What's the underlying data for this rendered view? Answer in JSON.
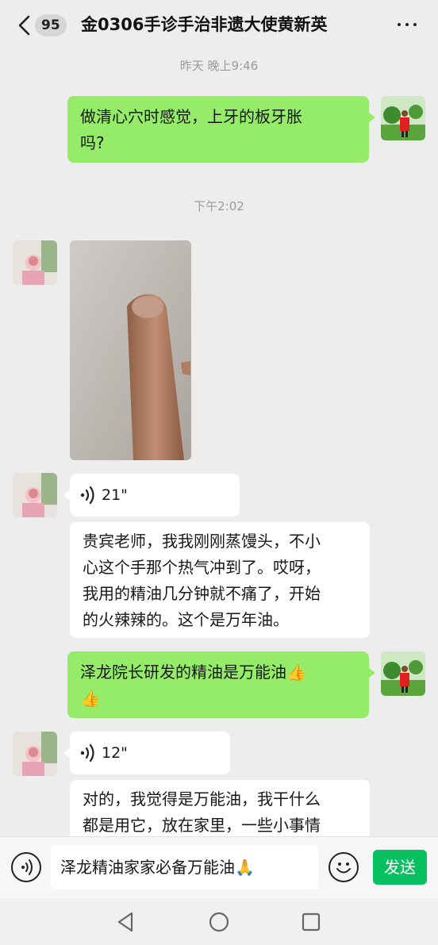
{
  "header": {
    "unread_count": "95",
    "title": "金0306手诊手治非遗大使黄新英"
  },
  "messages": {
    "ts1": "昨天 晚上9:46",
    "msg1_line1": "做清心穴时感觉，上牙的板牙胀",
    "msg1_line2": "吗?",
    "ts2": "下午2:02",
    "voice1_duration": "21\"",
    "msg2_line1": "贵宾老师，我我刚刚蒸馒头，不小",
    "msg2_line2": "心这个手那个热气冲到了。哎呀，",
    "msg2_line3": "我用的精油几分钟就不痛了，开始",
    "msg2_line4": "的火辣辣的。这个是万年油。",
    "msg3_line1": "泽龙院长研发的精油是万能油",
    "msg3_emoji1": "👍",
    "msg3_emoji2": "👍",
    "voice2_duration": "12\"",
    "msg4_line1": "对的，我觉得是万能油，我干什么",
    "msg4_line2": "都是用它，放在家里，一些小事情"
  },
  "input": {
    "value": "泽龙精油家家必备万能油",
    "emoji": "🙏"
  },
  "send_label": "发送",
  "colors": {
    "my_bubble": "#95ec69",
    "other_bubble": "#ffffff",
    "send_button": "#07c160",
    "background": "#ededed"
  },
  "icons": [
    "back-chevron-icon",
    "more-icon",
    "voice-wave-icon",
    "voice-input-icon",
    "emoji-icon",
    "nav-back-icon",
    "nav-home-icon",
    "nav-recents-icon"
  ]
}
